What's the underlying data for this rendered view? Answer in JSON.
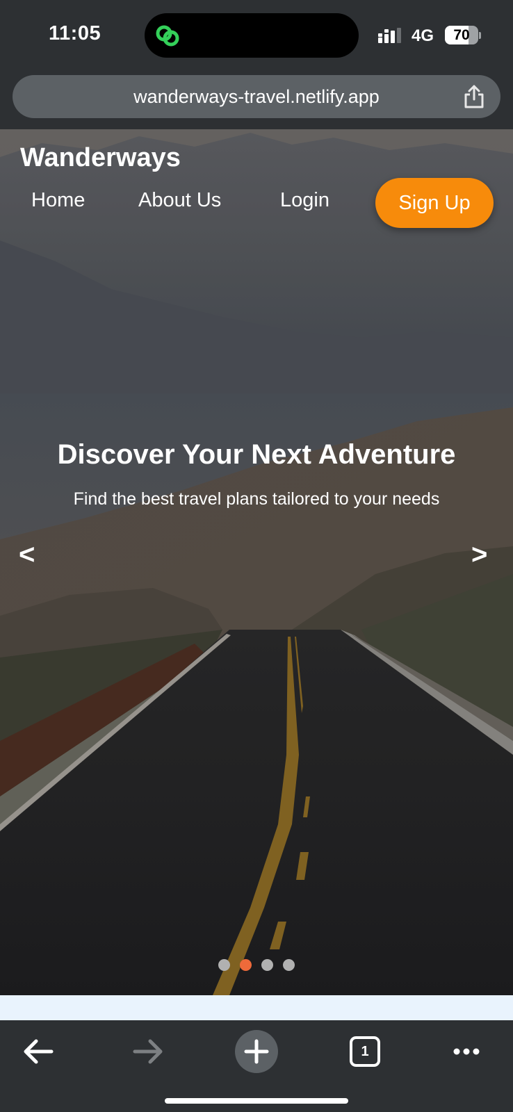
{
  "status_bar": {
    "time": "11:05",
    "network": "4G",
    "battery_level": 70,
    "battery_text": "70",
    "island_icon": "link-rings-icon",
    "island_icon_color": "#34d05a"
  },
  "browser": {
    "url": "wanderways-travel.netlify.app",
    "share_icon": "share-icon"
  },
  "header": {
    "brand": "Wanderways",
    "nav": [
      {
        "label": "Home"
      },
      {
        "label": "About Us"
      },
      {
        "label": "Login"
      }
    ],
    "signup_label": "Sign Up",
    "accent_color": "#f78b0b"
  },
  "hero": {
    "title": "Discover Your Next Adventure",
    "subtitle": "Find the best travel plans tailored to your needs",
    "prev_arrow": "<",
    "next_arrow": ">",
    "slide_count": 4,
    "active_slide": 2,
    "active_dot_color": "#ee6a3a",
    "image": "desert-road-mountains-photo"
  },
  "toolbar": {
    "buttons": [
      "back-arrow-icon",
      "forward-arrow-icon",
      "new-tab-plus-icon",
      "tabs-count-icon",
      "more-dots-icon"
    ],
    "tab_count": "1"
  }
}
